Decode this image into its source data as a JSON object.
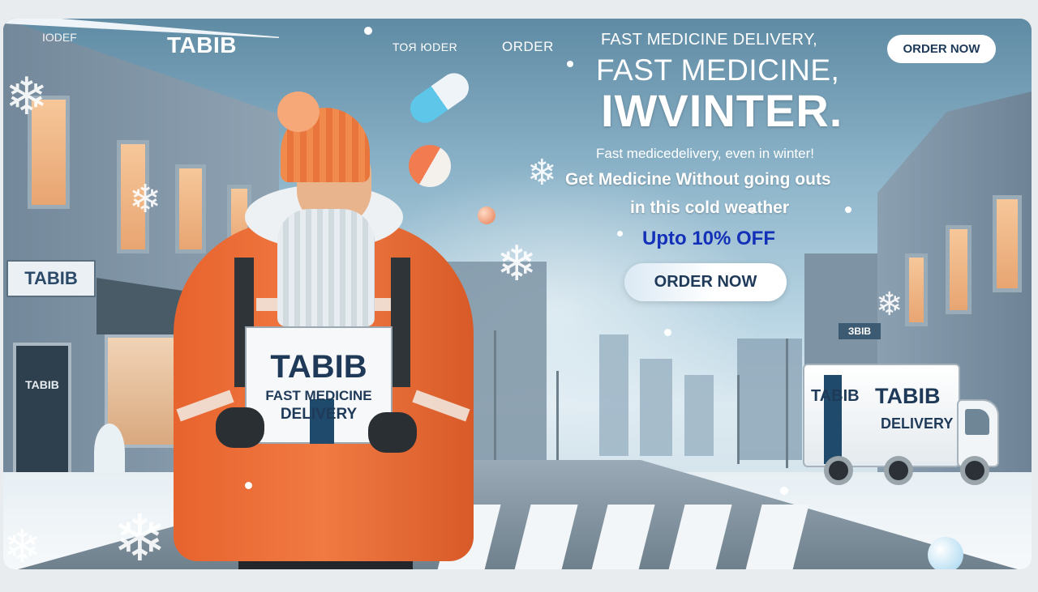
{
  "nav": {
    "corner_text": "ІОDEF",
    "logo": "TABIB",
    "link_1": "ТОЯ ЮDER",
    "link_2": "ORDER",
    "order_button": "ORDER NOW"
  },
  "hero": {
    "kicker": "FAST MEDICINE DELIVERY,",
    "title_line1": "FAST MEDICINE,",
    "title_line2": "IWVINTER.",
    "tagline": "Fast medicedelivery, even in winter!",
    "copy_line1": "Get Medicine Without  going outs",
    "copy_line2": "in this cold weather",
    "discount": "Upto 10% OFF",
    "order_button": "ORDER NOW"
  },
  "scene": {
    "store_sign": "TABIB",
    "door_sign": "TABIB",
    "street_sign": "ЗBIB",
    "box": {
      "brand": "TABIB",
      "line1": "FAST MEDICINE",
      "line2": "DELIVERY"
    },
    "van": {
      "brand_small": "TABIB",
      "brand_large": "TABIB",
      "subtitle": "DELIVERY"
    }
  },
  "colors": {
    "accent_orange": "#f07a42",
    "brand_navy": "#1f3a59",
    "discount_blue": "#1330b8"
  }
}
